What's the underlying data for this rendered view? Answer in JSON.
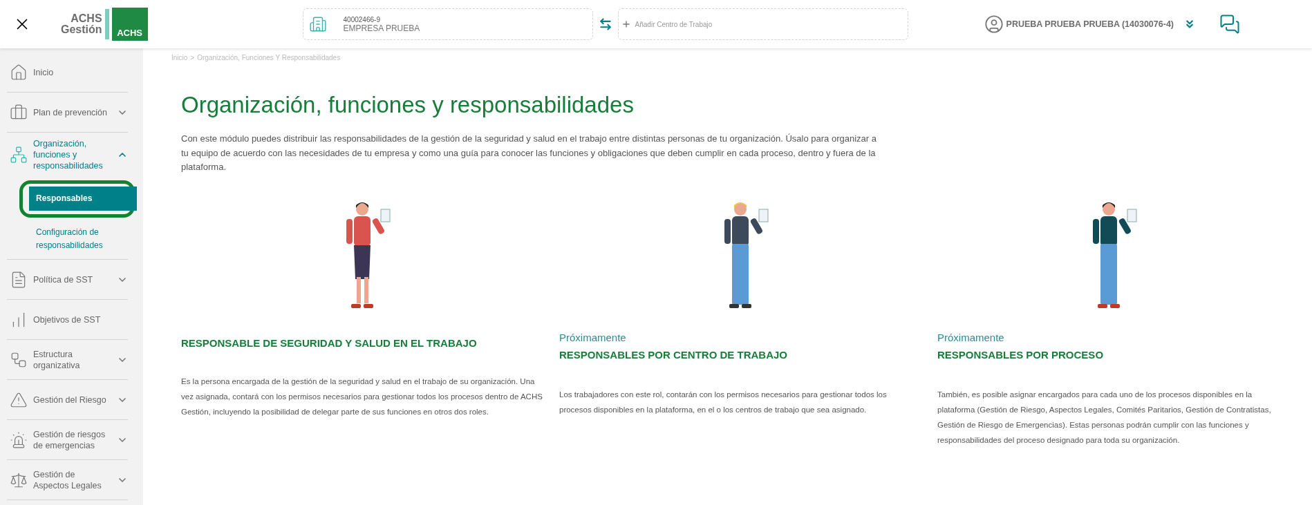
{
  "header": {
    "logo": {
      "lines": [
        "ACHS",
        "Gestión"
      ],
      "badge": "ACHS"
    },
    "company": {
      "id": "40002466-9",
      "name": "EMPRESA PRUEBA"
    },
    "add_center": {
      "placeholder": "Añadir Centro de Trabajo"
    },
    "user": {
      "name": "PRUEBA PRUEBA PRUEBA (14030076-4)"
    }
  },
  "sidebar": {
    "items": [
      {
        "label": "Inicio",
        "kind": "link"
      },
      {
        "label": "Plan de prevención",
        "kind": "group",
        "expanded": false
      },
      {
        "label": "Organización, funciones y responsabilidades",
        "kind": "group",
        "expanded": true,
        "children": [
          {
            "label": "Responsables",
            "selected": true,
            "highlighted": true
          },
          {
            "label": "Configuración de responsabilidades",
            "selected": false,
            "highlighted": false
          }
        ]
      },
      {
        "label": "Política de SST",
        "kind": "group",
        "expanded": false
      },
      {
        "label": "Objetivos de SST",
        "kind": "link"
      },
      {
        "label": "Estructura organizativa",
        "kind": "group",
        "expanded": false
      },
      {
        "label": "Gestión del Riesgo",
        "kind": "group",
        "expanded": false
      },
      {
        "label": "Gestión de riesgos de emergencias",
        "kind": "group",
        "expanded": false
      },
      {
        "label": "Gestión de Aspectos Legales",
        "kind": "group",
        "expanded": false
      }
    ]
  },
  "breadcrumb": {
    "separator": ">",
    "items": [
      "Inicio",
      "Organización, Funciones Y Responsabilidades"
    ]
  },
  "title": "Organización, funciones y responsabilidades",
  "description": "Con este módulo puedes distribuir las responsabilidades de la gestión de la seguridad y salud en el trabajo entre distintas personas de tu organización. Úsalo para organizar a tu equipo de acuerdo con las necesidades de tu empresa y como una guía para conocer las funciones y obligaciones que deben cumplir en cada proceso, dentro y fuera de la plataforma.",
  "cards": [
    {
      "kind": "manager",
      "title": "RESPONSABLE DE SEGURIDAD Y SALUD EN EL TRABAJO",
      "body": "Es la persona encargada de la gestión de la seguridad y salud en el trabajo de su organización. Una vez asignada, contará con los permisos necesarios para gestionar todos los procesos dentro de ACHS Gestión, incluyendo la posibilidad de delegar parte de sus funciones en otros dos roles."
    },
    {
      "kind": "worker",
      "status": "Próximamente",
      "title": "RESPONSABLES POR CENTRO DE TRABAJO",
      "body": "Los trabajadores con este rol, contarán con los permisos necesarios para gestionar todos los procesos disponibles en la plataforma, en el o los centros de trabajo que sea asignado."
    },
    {
      "kind": "mechanic",
      "status": "Próximamente",
      "title": "RESPONSABLES POR PROCESO",
      "body": "También, es posible asignar encargados para cada uno de los procesos disponibles en la plataforma (Gestión de Riesgo, Aspectos Legales, Comités Paritarios, Gestión de Contratistas, Gestión de Riesgo de Emergencias). Estas personas podrán cumplir con las funciones y responsabilidades del proceso designado para toda su organización."
    }
  ]
}
